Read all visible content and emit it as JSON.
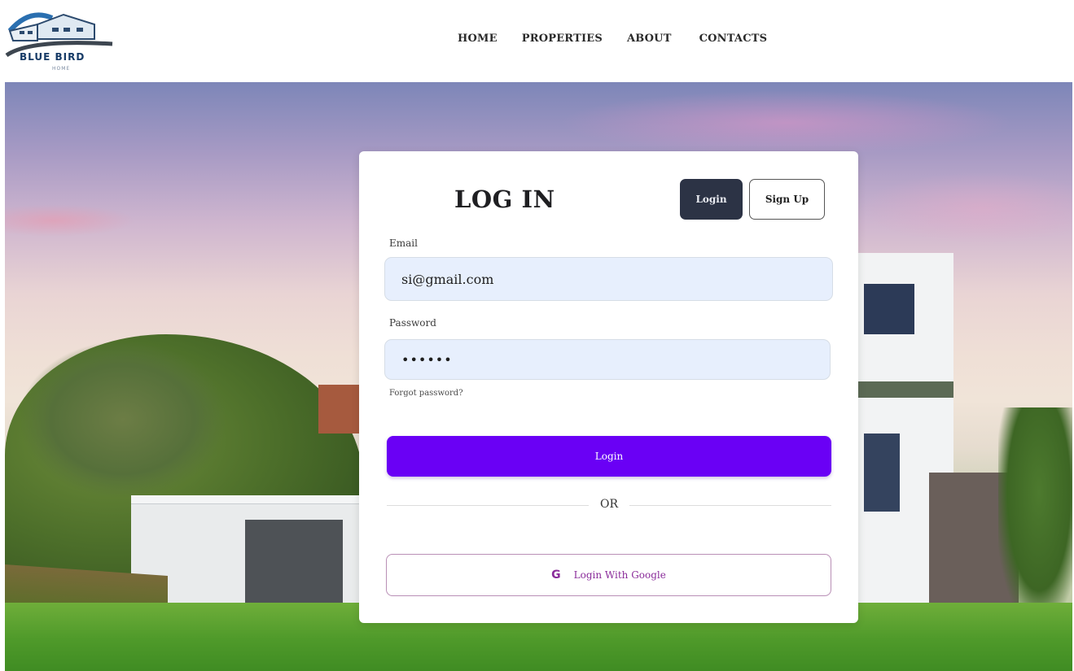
{
  "brand": {
    "name": "BLUE BIRD",
    "tagline": "HOME",
    "accent_color": "#163a66"
  },
  "nav": {
    "items": [
      {
        "label": "HOME"
      },
      {
        "label": "PROPERTIES"
      },
      {
        "label": "ABOUT"
      },
      {
        "label": "CONTACTS"
      }
    ]
  },
  "login_card": {
    "title": "LOG IN",
    "tabs": [
      {
        "label": "Login",
        "active": true
      },
      {
        "label": "Sign Up",
        "active": false
      }
    ],
    "email": {
      "label": "Email",
      "value": "si@gmail.com"
    },
    "password": {
      "label": "Password",
      "value": "••••••"
    },
    "forgot_label": "Forgot password?",
    "submit_label": "Login",
    "divider_label": "OR",
    "google": {
      "icon": "google-icon",
      "label": "Login With Google"
    },
    "colors": {
      "primary": "#6a00f5",
      "tab_active": "#2c3345",
      "input_bg": "#e7effd",
      "google_text": "#8a2c9a"
    }
  }
}
